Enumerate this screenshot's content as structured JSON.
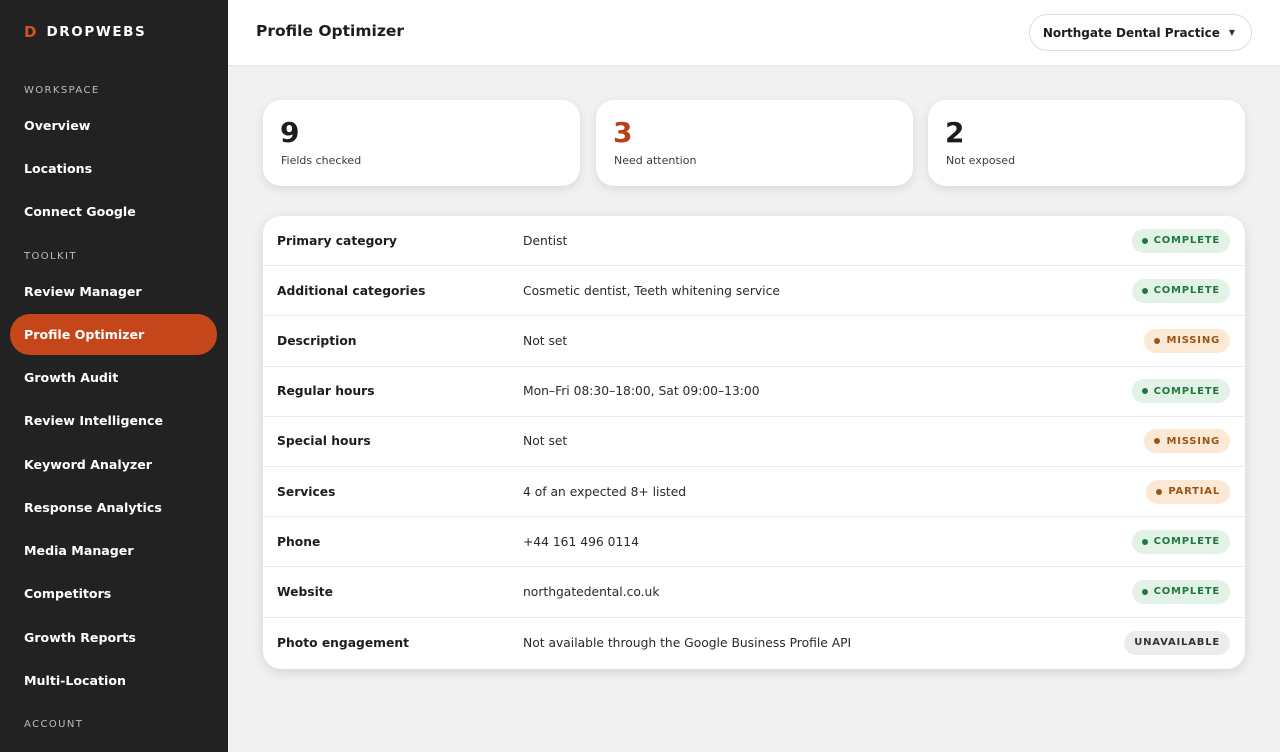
{
  "sidebar": {
    "brand_mark": "D",
    "brand_name": "DROPWEBS",
    "sections": {
      "workspace": "WORKSPACE",
      "toolkit": "TOOLKIT",
      "account": "ACCOUNT"
    },
    "workspace_items": [
      "Overview",
      "Locations",
      "Connect Google"
    ],
    "toolkit_items": [
      "Review Manager",
      "Profile Optimizer",
      "Growth Audit",
      "Review Intelligence",
      "Keyword Analyzer",
      "Response Analytics",
      "Media Manager",
      "Competitors",
      "Growth Reports",
      "Multi-Location"
    ],
    "active_item": "Profile Optimizer"
  },
  "header": {
    "title": "Profile Optimizer",
    "location": "Northgate Dental Practice",
    "chevron": "▼"
  },
  "stats": [
    {
      "value": "9",
      "label": "Fields checked"
    },
    {
      "value": "3",
      "label": "Need attention"
    },
    {
      "value": "2",
      "label": "Not exposed"
    }
  ],
  "rows": [
    {
      "field": "Primary category",
      "value": "Dentist",
      "status": "COMPLETE"
    },
    {
      "field": "Additional categories",
      "value": "Cosmetic dentist, Teeth whitening service",
      "status": "COMPLETE"
    },
    {
      "field": "Description",
      "value": "Not set",
      "status": "MISSING"
    },
    {
      "field": "Regular hours",
      "value": "Mon–Fri 08:30–18:00, Sat 09:00–13:00",
      "status": "COMPLETE"
    },
    {
      "field": "Special hours",
      "value": "Not set",
      "status": "MISSING"
    },
    {
      "field": "Services",
      "value": "4 of an expected 8+ listed",
      "status": "PARTIAL"
    },
    {
      "field": "Phone",
      "value": "+44 161 496 0114",
      "status": "COMPLETE"
    },
    {
      "field": "Website",
      "value": "northgatedental.co.uk",
      "status": "COMPLETE"
    },
    {
      "field": "Photo engagement",
      "value": "Not available through the Google Business Profile API",
      "status": "UNAVAILABLE"
    }
  ],
  "colors": {
    "accent": "#c4461a",
    "sidebar_bg": "#222222",
    "complete": "#1e7a3e",
    "missing": "#9a5414"
  }
}
